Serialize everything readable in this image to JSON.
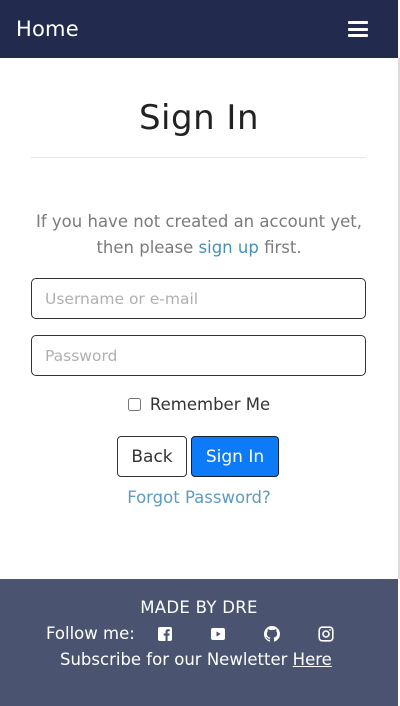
{
  "navbar": {
    "brand": "Home",
    "menu_icon": "hamburger-menu-icon"
  },
  "signin": {
    "title": "Sign In",
    "intro_before": "If you have not created an account yet, then please ",
    "signup_link": "sign up",
    "intro_after": " first.",
    "username_placeholder": "Username or e-mail",
    "password_placeholder": "Password",
    "remember_label": "Remember Me",
    "back_label": "Back",
    "signin_label": "Sign In",
    "forgot_label": "Forgot Password?"
  },
  "footer": {
    "made_by": "MADE BY DRE",
    "follow_label": "Follow me:",
    "social_icons": [
      "facebook-icon",
      "youtube-icon",
      "github-icon",
      "instagram-icon"
    ],
    "subscribe_text": "Subscribe for our Newletter ",
    "subscribe_link": "Here"
  },
  "colors": {
    "navbar_bg": "#222b4d",
    "footer_bg": "#4a5470",
    "primary_button": "#0d7bf7",
    "link": "#4a8fb3"
  }
}
